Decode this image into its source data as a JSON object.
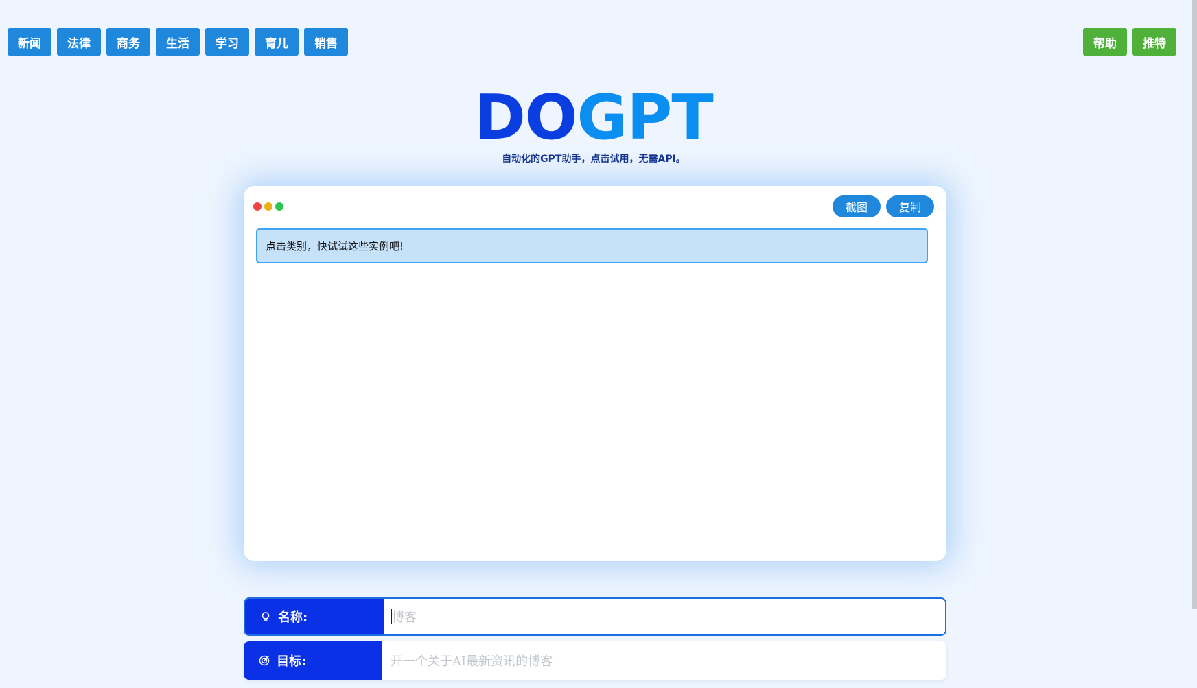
{
  "nav": {
    "left": [
      "新闻",
      "法律",
      "商务",
      "生活",
      "学习",
      "育儿",
      "销售"
    ],
    "right": [
      "帮助",
      "推特"
    ]
  },
  "logo": {
    "part_a": "DO",
    "part_b": "GPT",
    "subtitle": "自动化的GPT助手，点击试用，无需API。"
  },
  "output": {
    "screenshot_label": "截图",
    "copy_label": "复制",
    "message": "点击类别，快试试这些实例吧!"
  },
  "form": {
    "name": {
      "label": "名称:",
      "placeholder": "博客",
      "icon": "bulb-icon"
    },
    "goal": {
      "label": "目标:",
      "placeholder": "开一个关于AI最新资讯的博客",
      "icon": "target-icon"
    }
  },
  "colors": {
    "nav_blue": "#1f88dc",
    "nav_green": "#4fb03a",
    "label_blue": "#0a31e6",
    "logo_dark": "#0a3ee0",
    "logo_light": "#0a8ef0"
  }
}
